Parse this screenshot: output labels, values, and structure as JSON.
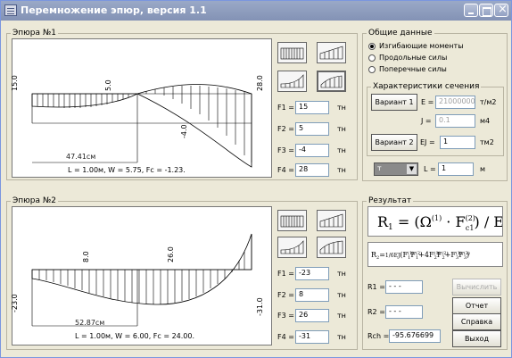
{
  "window": {
    "title": "Перемножение эпюр, версия 1.1"
  },
  "epure1": {
    "legend": "Эпюра №1",
    "tick_left": "15.0",
    "tick_mid": "5.0",
    "tick_right": "28.0",
    "tick_low": "-4.0",
    "dim": "47.41см",
    "info": "L = 1.00м,  W = 5.75,  Fc = -1.23.",
    "F1": "15",
    "F2": "5",
    "F3": "-4",
    "F4": "28",
    "unit": "тн"
  },
  "epure2": {
    "legend": "Эпюра №2",
    "tick_left": "-23.0",
    "tick_mid1": "8.0",
    "tick_mid2": "26.0",
    "tick_right": "-31.0",
    "dim": "52.87см",
    "info": "L = 1.00м,  W = 6.00,  Fc = 24.00.",
    "F1": "-23",
    "F2": "8",
    "F3": "26",
    "F4": "-31",
    "unit": "тн"
  },
  "labels": {
    "F1": "F1 =",
    "F2": "F2 =",
    "F3": "F3 =",
    "F4": "F4 ="
  },
  "general": {
    "legend": "Общие данные",
    "options": [
      "Изгибающие моменты",
      "Продольные силы",
      "Поперечные силы"
    ],
    "selected": 0
  },
  "section": {
    "legend": "Характеристики сечения",
    "variant1": "Вариант 1",
    "E_label": "E =",
    "E_value": "21000000",
    "E_unit": "т/м2",
    "J_label": "J =",
    "J_value": "0.1",
    "J_unit": "м4",
    "variant2": "Вариант 2",
    "EJ_label": "EJ =",
    "EJ_value": "1",
    "EJ_unit": "тм2",
    "select_value": "т",
    "L_label": "L =",
    "L_value": "1",
    "L_unit": "м"
  },
  "result": {
    "legend": "Результат",
    "R1_label": "R1 =",
    "R1_value": "- - -",
    "R2_label": "R2 =",
    "R2_value": "- - -",
    "Rch_label": "Rch =",
    "Rch_value": "-95.676699",
    "btn_compute": "Вычислить",
    "btn_report": "Отчет",
    "btn_help": "Справка",
    "btn_exit": "Выход"
  }
}
